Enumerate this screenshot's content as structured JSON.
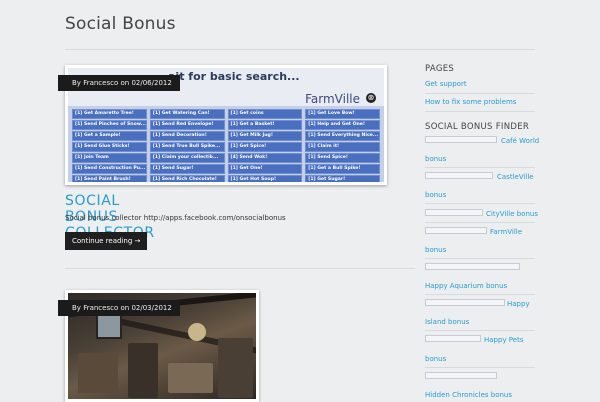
{
  "site": {
    "title": "Social Bonus"
  },
  "posts": [
    {
      "byline_prefix": "By",
      "author": "Francesco",
      "on": "on",
      "date": "02/06/2012",
      "title": "SOCIAL BONUS COLLECTOR",
      "excerpt": "Social bonus collector http://apps.facebook.com/onsocialbonus",
      "more_label": "Continue reading →",
      "thumb": {
        "search_text": "ait for basic search...",
        "brand": "FarmVille",
        "close_glyph": "⊗",
        "cells": [
          "[1] Get Amaretto Tree!",
          "[1] Get Watering Can!",
          "[1] Get coins",
          "[1] Get Love Bow!",
          "[1] Send Pinches of Snow...",
          "[1] Send Red Envelope!",
          "[1] Get a Basket!",
          "[1] Help and Get One!",
          "[1] Get a Sample!",
          "[1] Send Decoration!",
          "[1] Get Milk Jug!",
          "[1] Send Everything Nice...",
          "[1] Send Glue Sticks!",
          "[1] Send True Bull Spike...",
          "[1] Get Spice!",
          "[1] Claim it!",
          "[1] Join Team",
          "[1] Claim your collectib...",
          "[4] Send Wok!",
          "[1] Send Spice!",
          "[1] Send Construction Pu...",
          "[1] Send Sugar!",
          "[1] Get One!",
          "[1] Get a Bull Spike!",
          "[1] Send Paint Brush!",
          "[1] Send Rich Chocolate!",
          "[1] Get Hot Soup!",
          "[1] Get Sugar!"
        ]
      }
    },
    {
      "byline_prefix": "By",
      "author": "Francesco",
      "on": "on",
      "date": "02/03/2012"
    }
  ],
  "sidebar": {
    "pages_title": "PAGES",
    "pages": [
      "Get support",
      "How to fix some problems"
    ],
    "finder_title": "SOCIAL BONUS FINDER",
    "finder_items": [
      {
        "name": "Café World",
        "suffix": "bonus"
      },
      {
        "name": "CastleVille",
        "suffix": "bonus"
      },
      {
        "name": "CityVille bonus",
        "suffix": ""
      },
      {
        "name": "FarmVille",
        "suffix": "bonus"
      },
      {
        "name": "Happy Aquarium bonus",
        "suffix": ""
      },
      {
        "name": "Happy Island bonus",
        "suffix": ""
      },
      {
        "name": "Happy Pets",
        "suffix": "bonus"
      },
      {
        "name": "Hidden Chronicles bonus",
        "suffix": ""
      }
    ]
  },
  "colors": {
    "link": "#2a9bd0",
    "byline_bg": "#1b1b1b",
    "background": "#eceeef"
  }
}
